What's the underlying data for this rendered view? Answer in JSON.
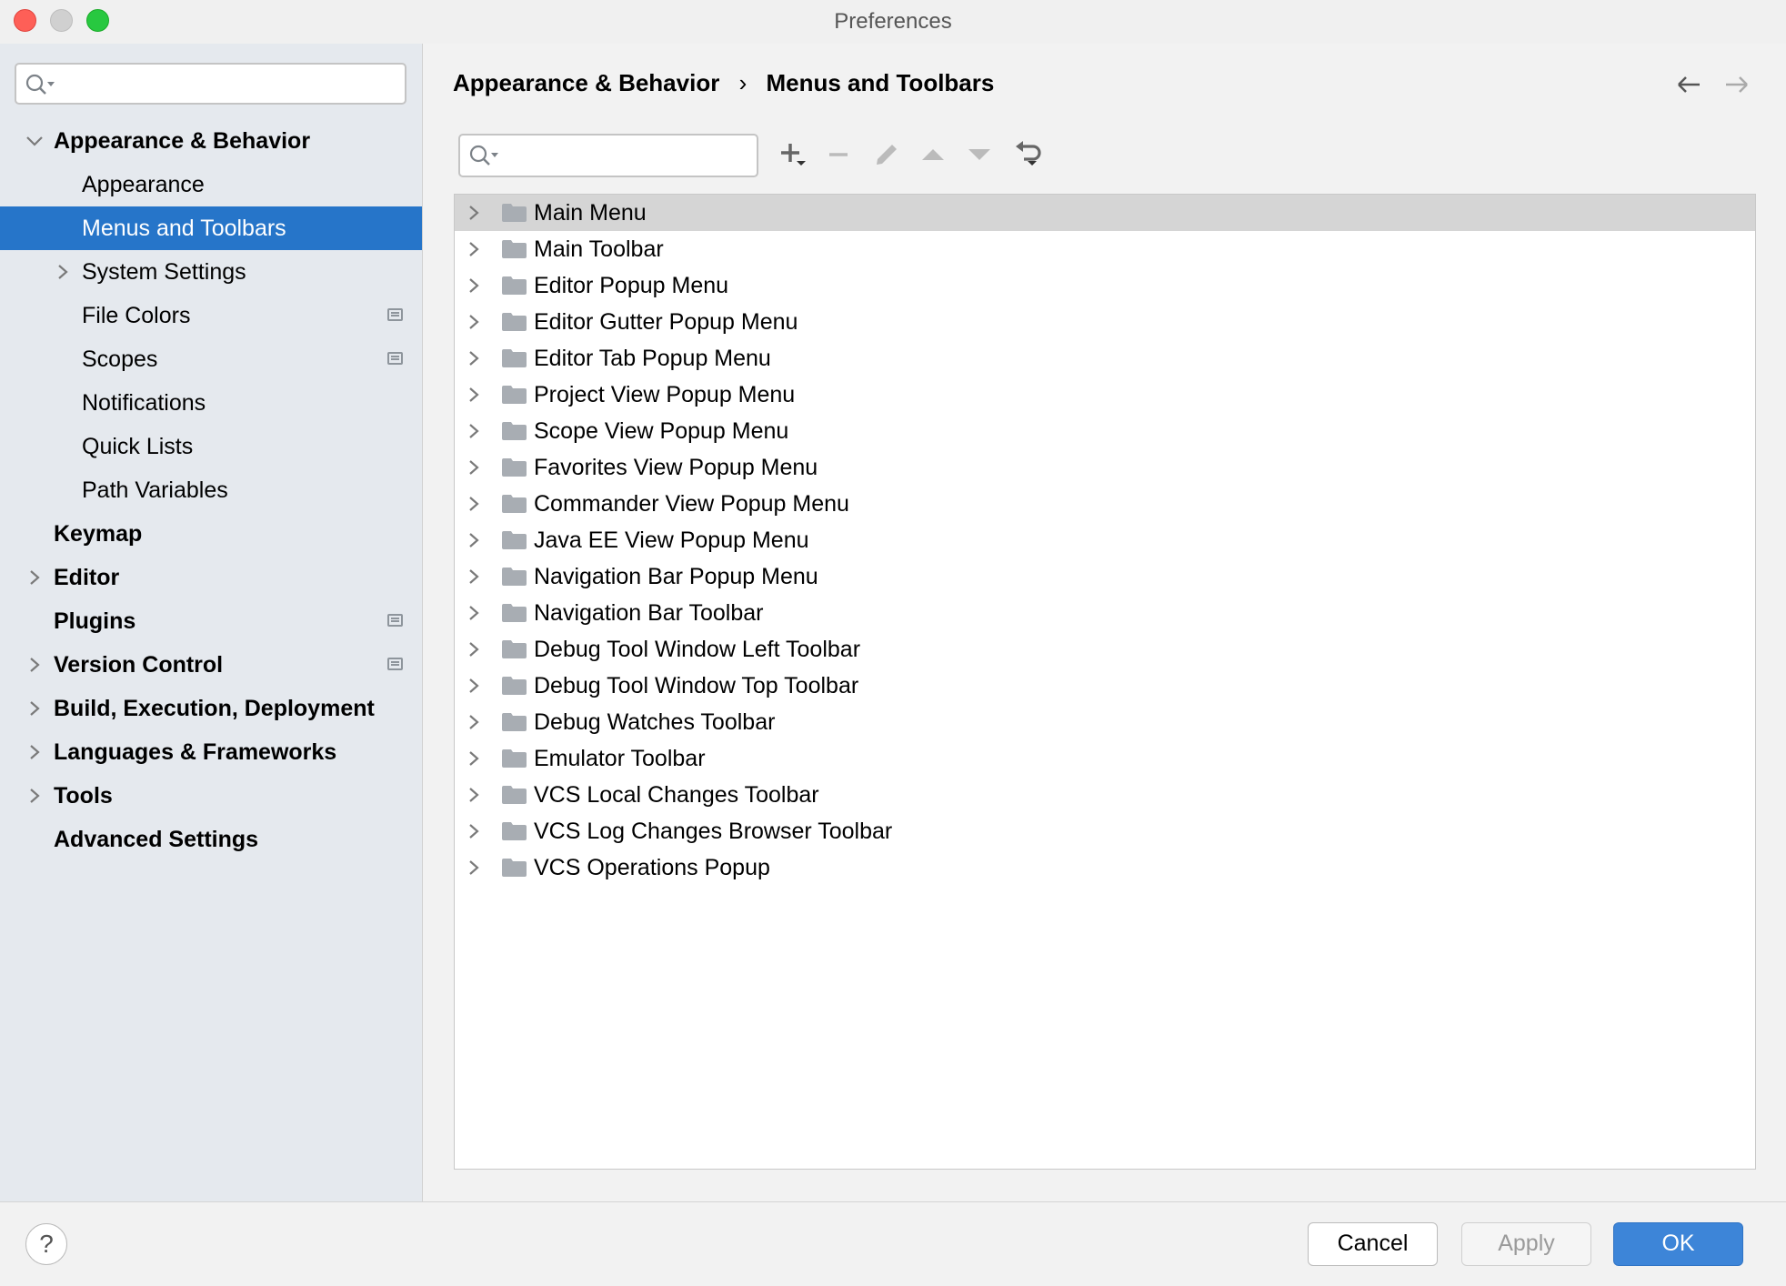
{
  "window": {
    "title": "Preferences"
  },
  "sidebar": {
    "search_placeholder": "",
    "items": [
      {
        "label": "Appearance & Behavior",
        "level": 0,
        "bold": true,
        "chevron": "down"
      },
      {
        "label": "Appearance",
        "level": 1
      },
      {
        "label": "Menus and Toolbars",
        "level": 1,
        "selected": true
      },
      {
        "label": "System Settings",
        "level": 1,
        "chevron": "right"
      },
      {
        "label": "File Colors",
        "level": 1,
        "badge": true
      },
      {
        "label": "Scopes",
        "level": 1,
        "badge": true
      },
      {
        "label": "Notifications",
        "level": 1
      },
      {
        "label": "Quick Lists",
        "level": 1
      },
      {
        "label": "Path Variables",
        "level": 1
      },
      {
        "label": "Keymap",
        "level": 0,
        "bold": true
      },
      {
        "label": "Editor",
        "level": 0,
        "bold": true,
        "chevron": "right"
      },
      {
        "label": "Plugins",
        "level": 0,
        "bold": true,
        "badge": true
      },
      {
        "label": "Version Control",
        "level": 0,
        "bold": true,
        "chevron": "right",
        "badge": true
      },
      {
        "label": "Build, Execution, Deployment",
        "level": 0,
        "bold": true,
        "chevron": "right"
      },
      {
        "label": "Languages & Frameworks",
        "level": 0,
        "bold": true,
        "chevron": "right"
      },
      {
        "label": "Tools",
        "level": 0,
        "bold": true,
        "chevron": "right"
      },
      {
        "label": "Advanced Settings",
        "level": 0,
        "bold": true
      }
    ]
  },
  "breadcrumb": {
    "parent": "Appearance & Behavior",
    "separator": "›",
    "current": "Menus and Toolbars"
  },
  "toolbar": {
    "search_placeholder": ""
  },
  "tree": {
    "items": [
      "Main Menu",
      "Main Toolbar",
      "Editor Popup Menu",
      "Editor Gutter Popup Menu",
      "Editor Tab Popup Menu",
      "Project View Popup Menu",
      "Scope View Popup Menu",
      "Favorites View Popup Menu",
      "Commander View Popup Menu",
      "Java EE View Popup Menu",
      "Navigation Bar Popup Menu",
      "Navigation Bar Toolbar",
      "Debug Tool Window Left Toolbar",
      "Debug Tool Window Top Toolbar",
      "Debug Watches Toolbar",
      "Emulator Toolbar",
      "VCS Local Changes Toolbar",
      "VCS Log Changes Browser Toolbar",
      "VCS Operations Popup"
    ],
    "selected_index": 0
  },
  "footer": {
    "help": "?",
    "cancel": "Cancel",
    "apply": "Apply",
    "ok": "OK"
  },
  "colors": {
    "accent": "#2675c9",
    "ok": "#3d85d8"
  }
}
